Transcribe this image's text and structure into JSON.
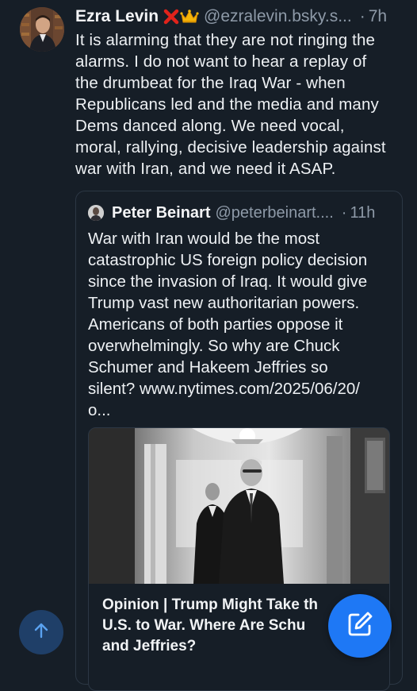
{
  "post": {
    "author_name": "Ezra Levin",
    "author_handle": "@ezralevin.bsky.s...",
    "separator": "·",
    "timestamp": "7h",
    "text": "It is alarming that they are not ringing the\nalarms. I do not want to hear a replay of\nthe drumbeat for the Iraq War - when\nRepublicans led and the media and many\nDems danced along. We need vocal,\nmoral, rallying, decisive leadership against\nwar with Iran, and we need it ASAP.",
    "badges": [
      "x-mark-icon",
      "crown-icon"
    ]
  },
  "quote": {
    "author_name": "Peter Beinart",
    "author_handle": "@peterbeinart....",
    "separator": "·",
    "timestamp": "11h",
    "text": "War with Iran would be the most\ncatastrophic US foreign policy decision\nsince the invasion of Iraq. It would give\nTrump vast new authoritarian powers.\nAmericans of both parties oppose it\noverwhelmingly. So why are Chuck\nSchumer and Hakeem Jeffries so\nsilent? www.nytimes.com/2025/06/20/\no...",
    "link_card": {
      "title": "Opinion | Trump Might Take th\nU.S. to War. Where Are Schu\nand Jeffries?"
    }
  },
  "buttons": {
    "scroll_top_icon": "arrow-up-icon",
    "compose_icon": "compose-icon"
  },
  "colors": {
    "background": "#161e27",
    "accent": "#1e78f5",
    "muted_text": "#8e9aa8",
    "border": "#2c3744"
  }
}
